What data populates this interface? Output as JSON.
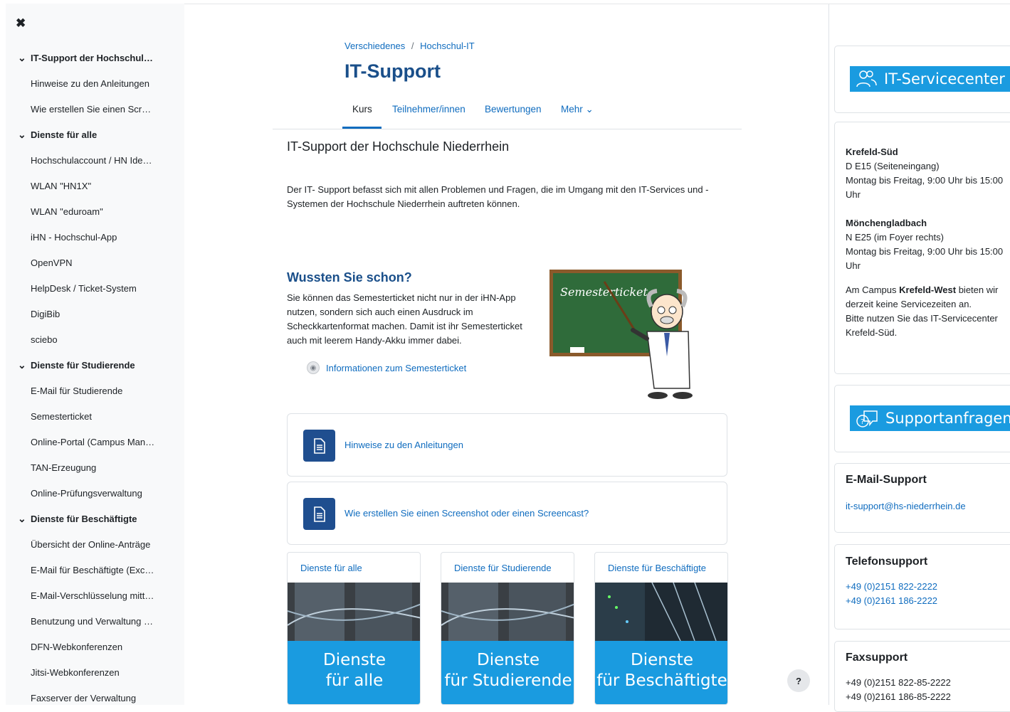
{
  "drawer": {
    "close_label": "✖",
    "items": [
      {
        "type": "section",
        "label": "IT-Support der Hochschul…"
      },
      {
        "type": "item",
        "label": "Hinweise zu den Anleitungen"
      },
      {
        "type": "item",
        "label": "Wie erstellen Sie einen Scr…"
      },
      {
        "type": "section",
        "label": "Dienste für alle"
      },
      {
        "type": "item",
        "label": "Hochschulaccount / HN Ide…"
      },
      {
        "type": "item",
        "label": "WLAN \"HN1X\""
      },
      {
        "type": "item",
        "label": "WLAN \"eduroam\""
      },
      {
        "type": "item",
        "label": "iHN - Hochschul-App"
      },
      {
        "type": "item",
        "label": "OpenVPN"
      },
      {
        "type": "item",
        "label": "HelpDesk / Ticket-System"
      },
      {
        "type": "item",
        "label": "DigiBib"
      },
      {
        "type": "item",
        "label": "sciebo"
      },
      {
        "type": "section",
        "label": "Dienste für Studierende"
      },
      {
        "type": "item",
        "label": "E-Mail für Studierende"
      },
      {
        "type": "item",
        "label": "Semesterticket"
      },
      {
        "type": "item",
        "label": "Online-Portal (Campus Man…"
      },
      {
        "type": "item",
        "label": "TAN-Erzeugung"
      },
      {
        "type": "item",
        "label": "Online-Prüfungsverwaltung"
      },
      {
        "type": "section",
        "label": "Dienste für Beschäftigte"
      },
      {
        "type": "item",
        "label": "Übersicht der Online-Anträge"
      },
      {
        "type": "item",
        "label": "E-Mail für Beschäftigte (Exc…"
      },
      {
        "type": "item",
        "label": "E-Mail-Verschlüsselung mitt…"
      },
      {
        "type": "item",
        "label": "Benutzung und Verwaltung …"
      },
      {
        "type": "item",
        "label": "DFN-Webkonferenzen"
      },
      {
        "type": "item",
        "label": "Jitsi-Webkonferenzen"
      },
      {
        "type": "item",
        "label": "Faxserver der Verwaltung"
      }
    ]
  },
  "breadcrumb": {
    "first": "Verschiedenes",
    "sep": "/",
    "second": "Hochschul-IT"
  },
  "page_title": "IT-Support",
  "tabs": {
    "kurs": "Kurs",
    "teilnehmer": "Teilnehmer/innen",
    "bewertungen": "Bewertungen",
    "mehr": "Mehr ⌄"
  },
  "section": {
    "title": "IT-Support der Hochschule Niederrhein",
    "intro": "Der IT- Support befasst sich mit allen Problemen und Fragen, die im Umgang mit den IT-Services und -Systemen der Hochschule Niederrhein auftreten können."
  },
  "wissen": {
    "title": "Wussten Sie schon?",
    "text": "Sie können das Semesterticket nicht nur in der iHN-App nutzen, sondern sich auch einen Ausdruck im Scheckkartenformat machen. Damit ist ihr Semesterticket auch mit leerem Handy-Akku immer dabei.",
    "link": "Informationen zum Semesterticket",
    "board_text": "Semesterticket"
  },
  "activities": [
    "Hinweise zu den Anleitungen",
    "Wie erstellen Sie einen Screenshot oder einen Screencast?"
  ],
  "cards": [
    {
      "title": "Dienste für alle",
      "banner1": "Dienste",
      "banner2": "für alle"
    },
    {
      "title": "Dienste für Studierende",
      "banner1": "Dienste",
      "banner2": "für Studierende"
    },
    {
      "title": "Dienste für Beschäftigte",
      "banner1": "Dienste",
      "banner2": "für Beschäftigte"
    }
  ],
  "help_label": "?",
  "right": {
    "servicecenter": "IT-Servicecenter",
    "krefeld_sued": {
      "title": "Krefeld-Süd",
      "room": "D E15 (Seiteneingang)",
      "hours": "Montag bis Freitag, 9:00 Uhr bis 15:00 Uhr"
    },
    "mgladbach": {
      "title": "Mönchengladbach",
      "room": "N E25 (im Foyer rechts)",
      "hours": "Montag bis Freitag, 9:00 Uhr bis 15:00 Uhr"
    },
    "krefeld_west": {
      "pre": "Am Campus ",
      "bold": "Krefeld-West",
      "post": " bieten wir derzeit keine Servicezeiten an.",
      "line2": "Bitte nutzen Sie das IT-Servicecenter Krefeld-Süd."
    },
    "supportanfragen": "Supportanfragen",
    "email": {
      "title": "E-Mail-Support",
      "address": "it-support@hs-niederrhein.de"
    },
    "telefon": {
      "title": "Telefonsupport",
      "n1": "+49 (0)2151 822-2222",
      "n2": "+49 (0)2161 186-2222"
    },
    "fax": {
      "title": "Faxsupport",
      "n1": "+49 (0)2151 822-85-2222",
      "n2": "+49 (0)2161 186-85-2222"
    }
  },
  "colors": {
    "link": "#0f6cbf",
    "title": "#1a4f8a",
    "banner": "#1a9be0",
    "drawer_bg": "#f8f9fa"
  }
}
